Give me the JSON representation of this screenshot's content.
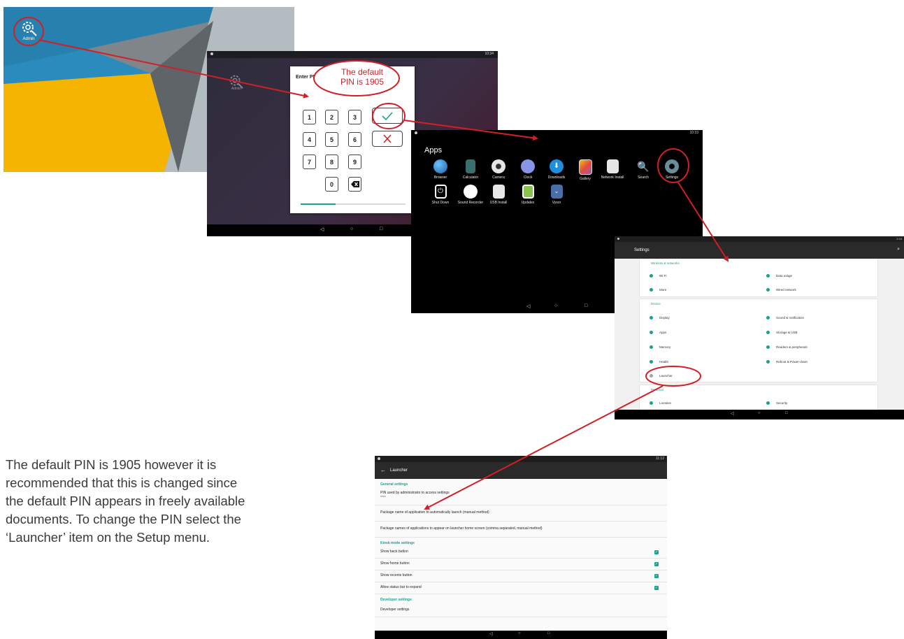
{
  "home": {
    "admin_label": "Admin"
  },
  "pin_screen": {
    "status_time": "10:34",
    "admin_label": "Admin",
    "dialog_title": "Enter PIN",
    "keys": [
      "1",
      "2",
      "3",
      "4",
      "5",
      "6",
      "7",
      "8",
      "9",
      "0"
    ],
    "progress_fraction": 0.33,
    "nav": [
      "◁",
      "○",
      "□"
    ]
  },
  "apps_screen": {
    "status_time": "10:33",
    "title": "Apps",
    "apps": [
      {
        "label": "Browser",
        "color": "#2f7fd1"
      },
      {
        "label": "Calculator",
        "color": "#3a7d78"
      },
      {
        "label": "Camera",
        "color": "#e6e6e6"
      },
      {
        "label": "Clock",
        "color": "#7c8ce0"
      },
      {
        "label": "Downloads",
        "color": "#1e8fe0"
      },
      {
        "label": "Gallery",
        "color": "#c7a84a"
      },
      {
        "label": "Network Install",
        "color": "#dddddd"
      },
      {
        "label": "Search",
        "color": "#dcdcdc"
      },
      {
        "label": "Settings",
        "color": "#6b8c9a"
      },
      {
        "label": "Shut Down",
        "color": "#ffffff"
      },
      {
        "label": "Sound Recorder",
        "color": "#d03030"
      },
      {
        "label": "USB Install",
        "color": "#dddddd"
      },
      {
        "label": "Updates",
        "color": "#8bc34a"
      },
      {
        "label": "Vysor",
        "color": "#4a6ea8"
      }
    ],
    "nav": [
      "◁",
      "○",
      "□"
    ]
  },
  "settings_screen": {
    "status_time": "2:16",
    "title": "Settings",
    "sections": [
      {
        "caption": "Wireless & networks",
        "items": [
          "Wi-Fi",
          "Data usage",
          "More",
          "Wired network"
        ]
      },
      {
        "caption": "Device",
        "items": [
          "Display",
          "Sound & notification",
          "Apps",
          "Storage & USB",
          "Memory",
          "Readers & peripherals",
          "Health",
          "Reboot & Power-down",
          "Launcher"
        ]
      },
      {
        "caption": "Personal",
        "items": [
          "Location",
          "Security"
        ]
      }
    ],
    "nav": [
      "◁",
      "○",
      "□"
    ]
  },
  "launcher_screen": {
    "status_time": "11:12",
    "title": "Launcher",
    "general_caption": "General settings",
    "pin_title": "PIN used by administrator to access settings",
    "pin_value": "****",
    "auto_launch": "Package name of application to automatically launch (manual method)",
    "home_packages": "Package names of applications to appear on launcher home screen (comma separated, manual method)",
    "kiosk_caption": "Kiosk mode settings",
    "kiosk_items": [
      "Show back button",
      "Show home button",
      "Show recents button",
      "Allow status bar to expand"
    ],
    "developer_caption": "Developer settings",
    "developer_item": "Developer settings",
    "nav": [
      "◁",
      "○",
      "□"
    ]
  },
  "callout": {
    "line1": "The default",
    "line2": "PIN is 1905"
  },
  "description": "The default PIN is 1905 however it is recommended that this is changed since the default PIN appears in freely available documents. To change the PIN select the ‘Launcher’ item on the Setup menu.",
  "colors": {
    "annotation_red": "#d11f26",
    "accent_teal": "#1aa18f"
  }
}
